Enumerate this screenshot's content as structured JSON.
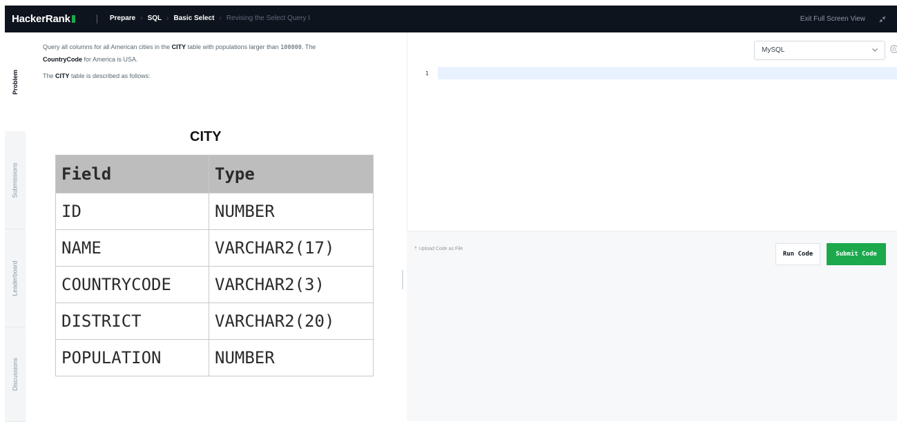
{
  "header": {
    "logo_text": "HackerRank",
    "breadcrumbs": [
      "Prepare",
      "SQL",
      "Basic Select"
    ],
    "current_page": "Revising the Select Query I",
    "exit_label": "Exit Full Screen View",
    "exit_icon": "minimize-icon"
  },
  "side_tabs": [
    "Problem",
    "Submissions",
    "Leaderboard",
    "Discussions"
  ],
  "problem": {
    "line1_a": "Query all columns for all American cities in the ",
    "line1_b": "CITY",
    "line1_c": " table with populations larger than ",
    "line1_d": "100000",
    "line1_e": ". The",
    "line2_a": "CountryCode",
    "line2_b": " for America is USA.",
    "line3_a": "The ",
    "line3_b": "CITY",
    "line3_c": " table is described as follows:",
    "table_title": "CITY",
    "columns": [
      "Field",
      "Type"
    ],
    "rows": [
      [
        "ID",
        "NUMBER"
      ],
      [
        "NAME",
        "VARCHAR2(17)"
      ],
      [
        "COUNTRYCODE",
        "VARCHAR2(3)"
      ],
      [
        "DISTRICT",
        "VARCHAR2(20)"
      ],
      [
        "POPULATION",
        "NUMBER"
      ]
    ]
  },
  "editor": {
    "language": "MySQL",
    "line_number": "1",
    "code": ""
  },
  "actions": {
    "upload_label": "Upload Code as File",
    "run_label": "Run Code",
    "submit_label": "Submit Code"
  },
  "colors": {
    "header_bg": "#0e141e",
    "brand_green": "#1ba94c"
  }
}
